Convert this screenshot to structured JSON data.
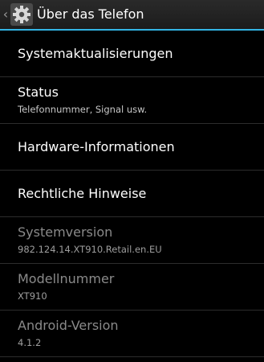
{
  "actionbar": {
    "title": "Über das Telefon",
    "up_glyph": "‹",
    "icon": "settings-gear-icon"
  },
  "colors": {
    "accent": "#33b5e5",
    "background": "#000000",
    "divider": "#2c2c2c",
    "disabled_text": "#8a8a8a"
  },
  "items": [
    {
      "title": "Systemaktualisierungen"
    },
    {
      "title": "Status",
      "summary": "Telefonnummer, Signal usw."
    },
    {
      "title": "Hardware-Informationen"
    },
    {
      "title": "Rechtliche Hinweise"
    },
    {
      "title": "Systemversion",
      "summary": "982.124.14.XT910.Retail.en.EU"
    },
    {
      "title": "Modellnummer",
      "summary": "XT910"
    },
    {
      "title": "Android-Version",
      "summary": "4.1.2"
    }
  ]
}
